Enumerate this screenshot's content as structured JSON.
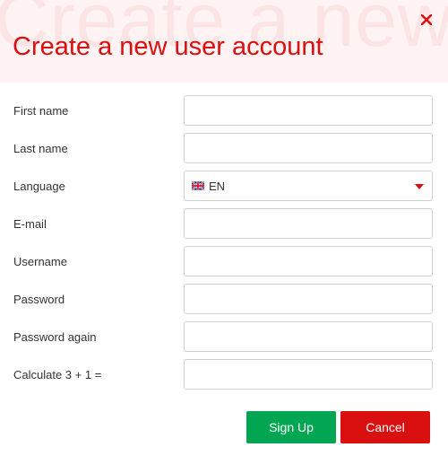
{
  "dialog": {
    "watermark_text": "Create a new",
    "title": "Create a new user account",
    "close_icon": "close-icon",
    "accent_color": "#d9100f",
    "success_color": "#00a651"
  },
  "form": {
    "first_name": {
      "label": "First name",
      "value": ""
    },
    "last_name": {
      "label": "Last name",
      "value": ""
    },
    "language": {
      "label": "Language",
      "value": "EN",
      "flag_icon": "uk-flag-icon"
    },
    "email": {
      "label": "E-mail",
      "value": ""
    },
    "username": {
      "label": "Username",
      "value": ""
    },
    "password": {
      "label": "Password",
      "value": ""
    },
    "password_again": {
      "label": "Password again",
      "value": ""
    },
    "captcha": {
      "label": "Calculate 3 + 1 =",
      "value": ""
    }
  },
  "buttons": {
    "signup_label": "Sign Up",
    "cancel_label": "Cancel"
  }
}
